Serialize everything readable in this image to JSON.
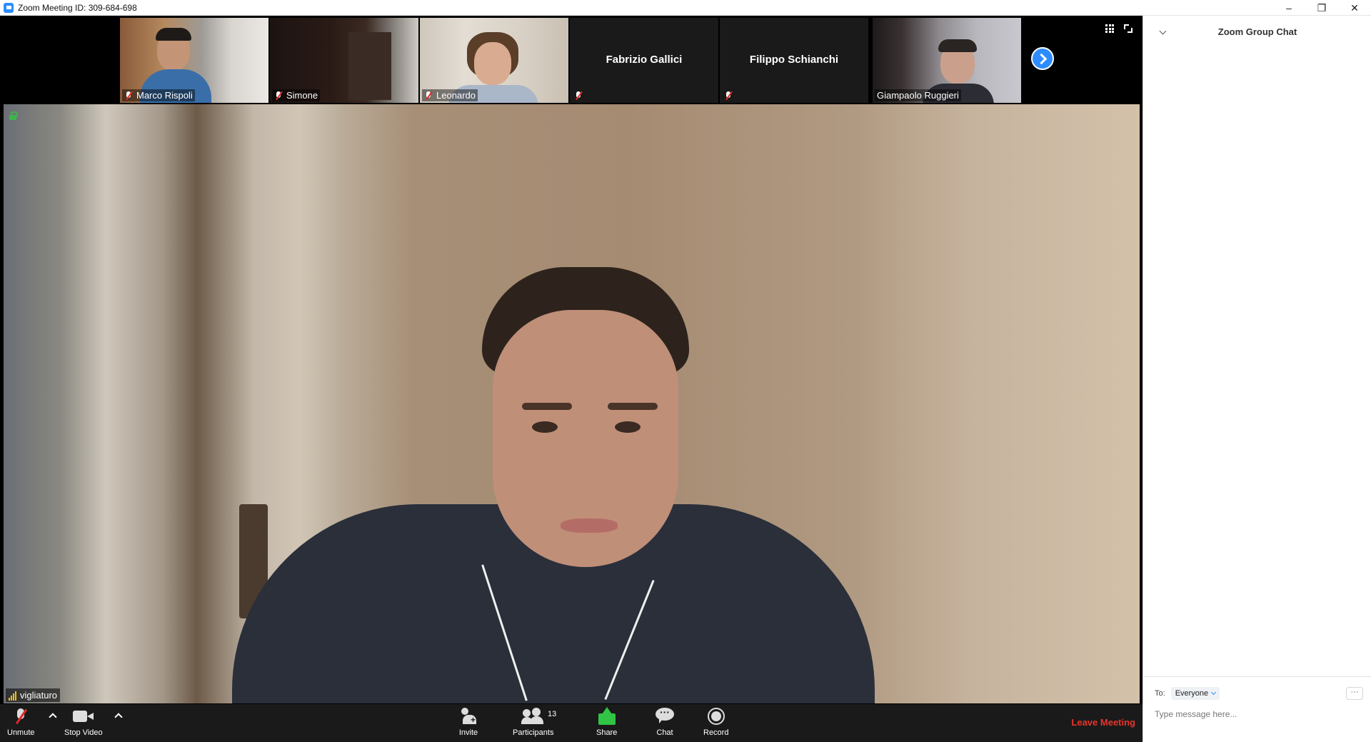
{
  "window": {
    "title": "Zoom Meeting ID: 309-684-698",
    "controls": {
      "minimize": "–",
      "restore": "❐",
      "close": "✕"
    }
  },
  "gallery": {
    "participants": [
      {
        "name": "Marco Rispoli",
        "muted": true,
        "video": true
      },
      {
        "name": "Simone",
        "muted": true,
        "video": true
      },
      {
        "name": "Leonardo",
        "muted": true,
        "video": true
      },
      {
        "name": "Fabrizio Gallici",
        "muted": true,
        "video": false
      },
      {
        "name": "Filippo Schianchi",
        "muted": true,
        "video": false
      },
      {
        "name": "Giampaolo Ruggieri",
        "muted": false,
        "video": true
      }
    ],
    "next_icon": "chevron-right-circle-icon",
    "view_icons": [
      "gallery-view-icon",
      "fullscreen-icon"
    ]
  },
  "main_video": {
    "active_speaker": "vigliaturo",
    "encryption_icon": "lock-icon",
    "signal_icon": "signal-bars-icon"
  },
  "toolbar": {
    "unmute_label": "Unmute",
    "stop_video_label": "Stop Video",
    "invite_label": "Invite",
    "participants_label": "Participants",
    "participants_count": "13",
    "share_label": "Share",
    "chat_label": "Chat",
    "record_label": "Record",
    "leave_label": "Leave Meeting"
  },
  "chat": {
    "title": "Zoom Group Chat",
    "to_label": "To:",
    "recipient": "Everyone",
    "more_label": "···",
    "placeholder": "Type message here..."
  },
  "colors": {
    "accent": "#2d8cff",
    "share_green": "#31c445",
    "leave_red": "#e8352b",
    "muted_red": "#e02828",
    "toolbar_bg": "#1a1a1a"
  }
}
